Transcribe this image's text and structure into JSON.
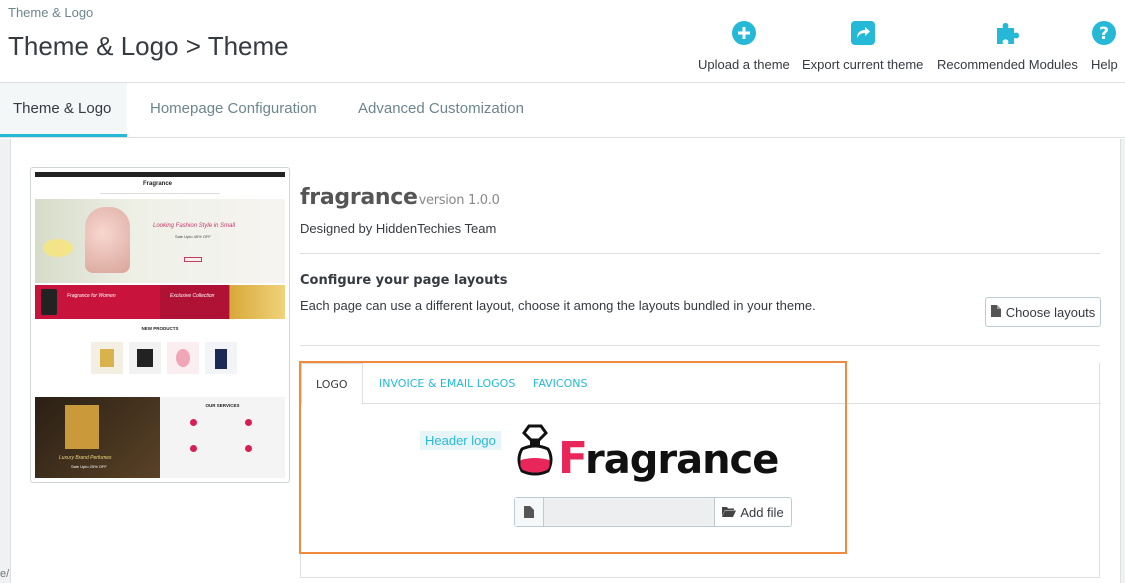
{
  "header": {
    "breadcrumb": "Theme & Logo",
    "title": "Theme & Logo > Theme",
    "actions": [
      {
        "label": "Upload a theme",
        "icon": "plus-circle-icon"
      },
      {
        "label": "Export current theme",
        "icon": "share-icon"
      },
      {
        "label": "Recommended Modules",
        "icon": "puzzle-icon"
      },
      {
        "label": "Help",
        "icon": "help-icon"
      }
    ]
  },
  "tabs": [
    {
      "label": "Theme & Logo",
      "active": true
    },
    {
      "label": "Homepage Configuration",
      "active": false
    },
    {
      "label": "Advanced Customization",
      "active": false
    }
  ],
  "theme": {
    "name": "fragrance",
    "version": "version 1.0.0",
    "designed_by": "Designed by HiddenTechies Team"
  },
  "layouts": {
    "title": "Configure your page layouts",
    "description": "Each page can use a different layout, choose it among the layouts bundled in your theme.",
    "button": "Choose layouts"
  },
  "logo_section": {
    "tabs": [
      {
        "label": "LOGO",
        "active": true
      },
      {
        "label": "INVOICE & EMAIL LOGOS",
        "active": false
      },
      {
        "label": "FAVICONS",
        "active": false
      }
    ],
    "header_logo_label": "Header logo",
    "logo_text_first": "F",
    "logo_text_rest": "ragrance",
    "add_file": "Add file"
  },
  "preview": {
    "brand": "Fragrance",
    "hero_text": "Looking Fashion Style in Small",
    "hero_sub": "Sale Upto 45% OFF",
    "banner1": "Fragrance for Women",
    "banner2": "Exclusive Collection",
    "new_products": "NEW PRODUCTS",
    "our_services": "OUR SERVICES",
    "lower_banner": "Luxury Brand Perfumes",
    "lower_banner_sub": "Sale Upto 25% OFF"
  },
  "edge_text": "e/",
  "colors": {
    "accent": "#25b9d7",
    "highlight": "#ef8b3e",
    "logo_pink": "#e8265a"
  }
}
